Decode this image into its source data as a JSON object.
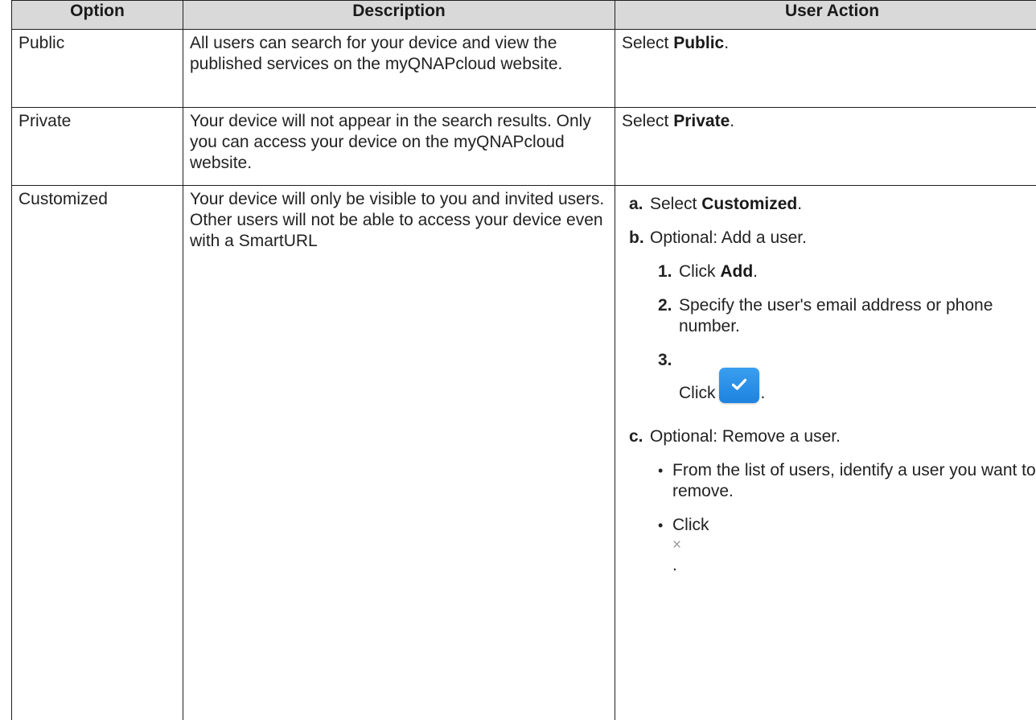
{
  "table": {
    "headers": [
      "Option",
      "Description",
      "User Action"
    ],
    "rows": [
      {
        "option": "Public",
        "description": "All users can search for your device and view the published services on the myQNAPcloud website.",
        "action_prefix": "Select ",
        "action_bold": "Public",
        "action_suffix": "."
      },
      {
        "option": "Private",
        "description": "Your device will not appear in the search results. Only you can access your device on the myQNAPcloud website.",
        "action_prefix": "Select ",
        "action_bold": "Private",
        "action_suffix": "."
      },
      {
        "option": "Customized",
        "description": "Your device will only be visible to you and invited users. Other users will not be able to access your device even with a SmartURL"
      }
    ]
  },
  "customized_steps": {
    "a": {
      "marker": "a.",
      "prefix": "Select ",
      "bold": "Customized",
      "suffix": "."
    },
    "b": {
      "marker": "b.",
      "text": "Optional: Add a user.",
      "substeps": {
        "s1": {
          "marker": "1.",
          "prefix": "Click ",
          "bold": "Add",
          "suffix": "."
        },
        "s2": {
          "marker": "2.",
          "text": "Specify the user's email address or phone number."
        },
        "s3": {
          "marker": "3.",
          "prefix": "Click",
          "suffix": ".",
          "icon": "checkmark-icon",
          "button_color": "#2a90e8"
        }
      }
    },
    "c": {
      "marker": "c.",
      "text": "Optional: Remove a user.",
      "bullets": {
        "b1": {
          "marker": "•",
          "text": "From the list of users, identify a user you want to remove."
        },
        "b2": {
          "marker": "•",
          "prefix": "Click",
          "icon_glyph": "×",
          "icon": "close-icon",
          "suffix": "."
        }
      }
    }
  },
  "colors": {
    "header_bg": "#d9d9d9",
    "border": "#1f1f1f",
    "text": "#222222"
  }
}
